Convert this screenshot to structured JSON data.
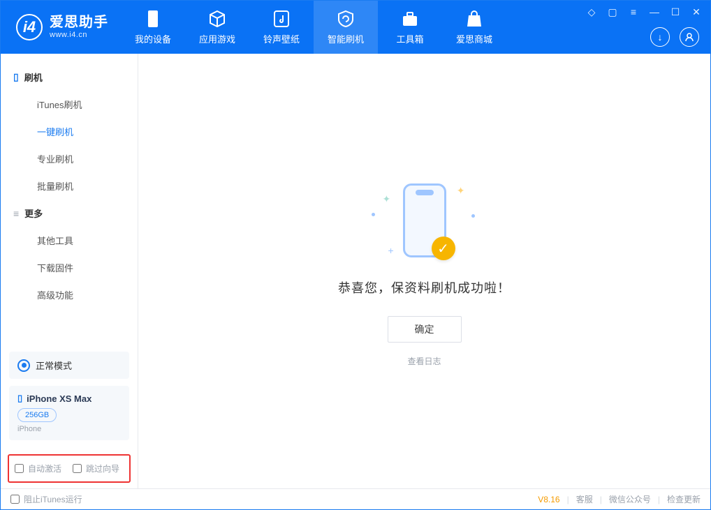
{
  "app": {
    "title": "爱思助手",
    "url": "www.i4.cn"
  },
  "tabs": [
    {
      "label": "我的设备"
    },
    {
      "label": "应用游戏"
    },
    {
      "label": "铃声壁纸"
    },
    {
      "label": "智能刷机"
    },
    {
      "label": "工具箱"
    },
    {
      "label": "爱思商城"
    }
  ],
  "sidebar": {
    "section1": {
      "title": "刷机",
      "items": [
        "iTunes刷机",
        "一键刷机",
        "专业刷机",
        "批量刷机"
      ]
    },
    "section2": {
      "title": "更多",
      "items": [
        "其他工具",
        "下载固件",
        "高级功能"
      ]
    }
  },
  "status": {
    "mode": "正常模式"
  },
  "device": {
    "name": "iPhone XS Max",
    "storage": "256GB",
    "type": "iPhone"
  },
  "checkboxes": {
    "auto_activate": "自动激活",
    "skip_guide": "跳过向导"
  },
  "main": {
    "success_text": "恭喜您，保资料刷机成功啦！",
    "confirm": "确定",
    "view_log": "查看日志"
  },
  "footer": {
    "block_itunes": "阻止iTunes运行",
    "version": "V8.16",
    "links": [
      "客服",
      "微信公众号",
      "检查更新"
    ]
  }
}
